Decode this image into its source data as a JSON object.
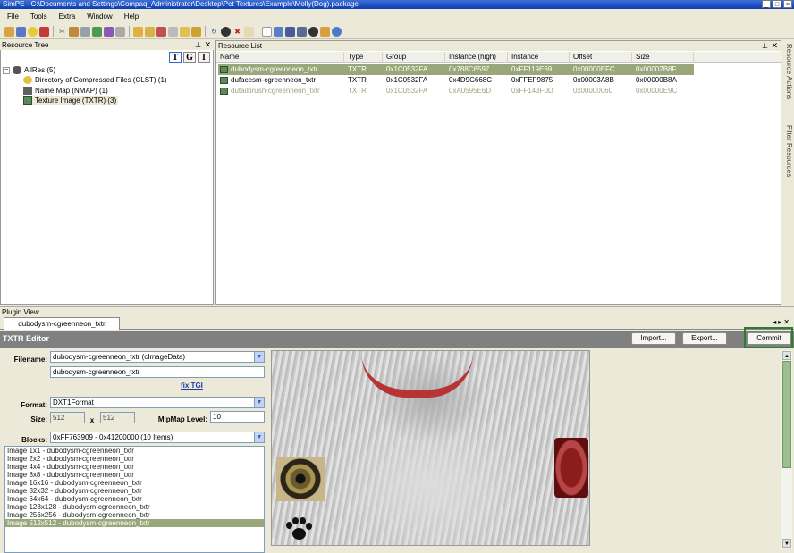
{
  "window": {
    "title": "SimPE - C:\\Documents and Settings\\Compaq_Administrator\\Desktop\\Pet Textures\\Example\\Molly(Dog).package",
    "controls": [
      "_",
      "□",
      "×"
    ]
  },
  "menu": [
    "File",
    "Tools",
    "Extra",
    "Window",
    "Help"
  ],
  "resource_tree": {
    "title": "Resource Tree",
    "toolbar": [
      "T",
      "G",
      "I"
    ],
    "root": "AllRes (5)",
    "children": [
      "Directory of Compressed Files (CLST) (1)",
      "Name Map (NMAP) (1)",
      "Texture Image (TXTR) (3)"
    ]
  },
  "resource_list": {
    "title": "Resource List",
    "columns": [
      "Name",
      "Type",
      "Group",
      "Instance (high)",
      "Instance",
      "Offset",
      "Size"
    ],
    "rows": [
      [
        "dubodysm-cgreenneon_txtr",
        "TXTR",
        "0x1C0532FA",
        "0x788C6597",
        "0xFF119E69",
        "0x00000EFC",
        "0x00002B8F"
      ],
      [
        "dufacesm-cgreenneon_txtr",
        "TXTR",
        "0x1C0532FA",
        "0x4D9C668C",
        "0xFFEF9875",
        "0x00003A8B",
        "0x00000B8A"
      ],
      [
        "dutailbrush-cgreenneon_txtr",
        "TXTR",
        "0x1C0532FA",
        "0xA0595E6D",
        "0xFF143F0D",
        "0x00000060",
        "0x00000E9C"
      ]
    ]
  },
  "side_tabs": [
    "Resource Actions",
    "Filter Resources"
  ],
  "plugin_view": {
    "title": "Plugin View",
    "tab": "dubodysm-cgreenneon_txtr"
  },
  "editor": {
    "title": "TXTR Editor",
    "import_label": "Import...",
    "export_label": "Export...",
    "commit_label": "Commit",
    "filename_label": "Filename:",
    "filename_value": "dubodysm-cgreenneon_txtr (cImageData)",
    "filename_text": "dubodysm-cgreenneon_txtr",
    "fix_tgi": "fix TGI",
    "format_label": "Format:",
    "format_value": "DXT1Format",
    "size_label": "Size:",
    "size_w": "512",
    "size_x": "x",
    "size_h": "512",
    "mipmap_label": "MipMap Level:",
    "mipmap_value": "10",
    "blocks_label": "Blocks:",
    "blocks_value": "0xFF763909 - 0x41200000 (10 Items)",
    "block_items": [
      "Image 1x1 - dubodysm-cgreenneon_txtr",
      "Image 2x2 - dubodysm-cgreenneon_txtr",
      "Image 4x4 - dubodysm-cgreenneon_txtr",
      "Image 8x8 - dubodysm-cgreenneon_txtr",
      "Image 16x16 - dubodysm-cgreenneon_txtr",
      "Image 32x32 - dubodysm-cgreenneon_txtr",
      "Image 64x64 - dubodysm-cgreenneon_txtr",
      "Image 128x128 - dubodysm-cgreenneon_txtr",
      "Image 256x256 - dubodysm-cgreenneon_txtr",
      "Image 512x512 - dubodysm-cgreenneon_txtr"
    ]
  }
}
